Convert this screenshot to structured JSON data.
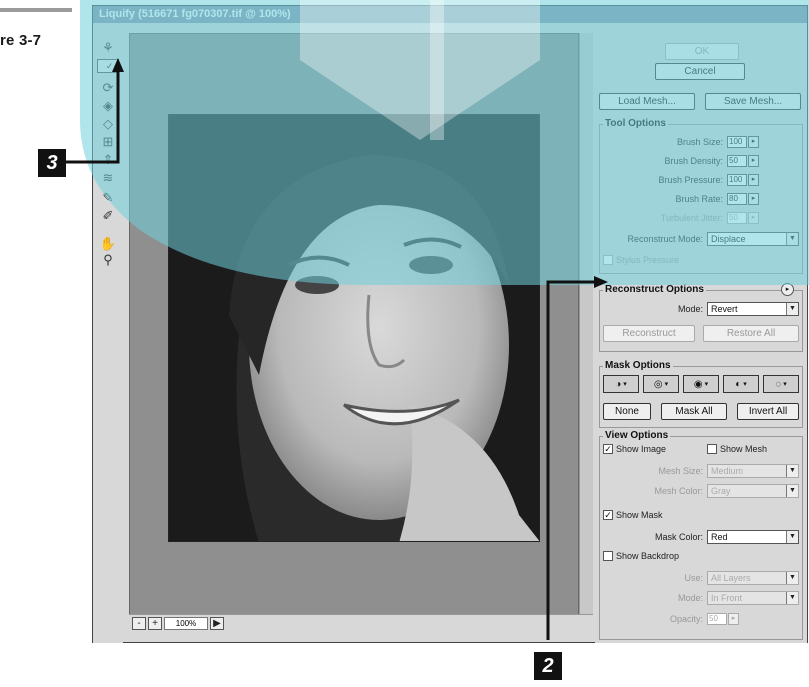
{
  "figure": {
    "label": "re 3-7",
    "callouts": [
      "3",
      "2"
    ]
  },
  "window": {
    "title": "Liquify (516671 fg070307.tif @ 100%)"
  },
  "tools": [
    "warp-tool-icon",
    "turbulence-tool-icon",
    "twirl-cw-icon",
    "twirl-ccw-icon",
    "pucker-icon",
    "bloat-icon",
    "shift-pixels-icon",
    "reflection-icon",
    "reconstruct-icon",
    "freeze-icon",
    "thaw-icon",
    "hand-icon",
    "zoom-icon"
  ],
  "status": {
    "minus": "-",
    "plus": "+",
    "zoom": "100%",
    "arrow": "▶"
  },
  "panel": {
    "ok": "OK",
    "cancel": "Cancel",
    "load_mesh": "Load Mesh...",
    "save_mesh": "Save Mesh...",
    "tool_options": {
      "title": "Tool Options",
      "brush_size": {
        "label": "Brush Size:",
        "value": "100"
      },
      "brush_density": {
        "label": "Brush Density:",
        "value": "50"
      },
      "brush_pressure": {
        "label": "Brush Pressure:",
        "value": "100"
      },
      "brush_rate": {
        "label": "Brush Rate:",
        "value": "80"
      },
      "turbulent_jitter": {
        "label": "Turbulent Jitter:",
        "value": "50"
      },
      "reconstruct_mode": {
        "label": "Reconstruct Mode:",
        "value": "Displace"
      },
      "stylus_pressure": "Stylus Pressure"
    },
    "reconstruct_options": {
      "title": "Reconstruct Options",
      "mode": {
        "label": "Mode:",
        "value": "Revert"
      },
      "reconstruct": "Reconstruct",
      "restore_all": "Restore All"
    },
    "mask_options": {
      "title": "Mask Options",
      "none": "None",
      "mask_all": "Mask All",
      "invert_all": "Invert All"
    },
    "view_options": {
      "title": "View Options",
      "show_image": "Show Image",
      "show_mesh": "Show Mesh",
      "mesh_size": {
        "label": "Mesh Size:",
        "value": "Medium"
      },
      "mesh_color": {
        "label": "Mesh Color:",
        "value": "Gray"
      },
      "show_mask": "Show Mask",
      "mask_color": {
        "label": "Mask Color:",
        "value": "Red"
      },
      "show_backdrop": "Show Backdrop",
      "use": {
        "label": "Use:",
        "value": "All Layers"
      },
      "mode": {
        "label": "Mode:",
        "value": "In Front"
      },
      "opacity": {
        "label": "Opacity:",
        "value": "50"
      }
    }
  },
  "colors": {
    "overlay": "#6fd0dc",
    "accent": "#111111"
  }
}
